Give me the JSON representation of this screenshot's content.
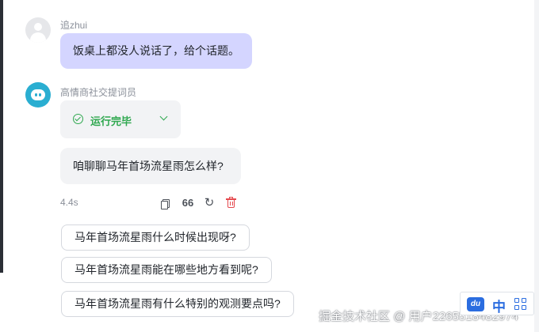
{
  "chat": {
    "user_message": {
      "username": "追zhui",
      "text": "饭桌上都没人说话了，给个话题。"
    },
    "bot_message": {
      "bot_name": "高情商社交提词员",
      "status_label": "运行完毕",
      "answer": "咱聊聊马年首场流星雨怎么样?",
      "elapsed_time": "4.4s",
      "toolbar": {
        "quote_label": "66"
      }
    },
    "suggestions": [
      "马年首场流星雨什么时候出现呀?",
      "马年首场流星雨能在哪些地方看到呢?",
      "马年首场流星雨有什么特别的观测要点吗?"
    ]
  },
  "watermark": "掘金技术社区 @ 用户2265518482974",
  "ime": {
    "logo_text": "du",
    "language": "中"
  },
  "colors": {
    "user_bubble": "#d4d5ff",
    "status_green": "#2fa84f",
    "delete_red": "#e5484d",
    "ime_blue": "#2b6de0"
  },
  "icons": {
    "status": "check-circle-icon",
    "toggle": "chevron-down-icon",
    "copy": "copy-icon",
    "quote": "quote-icon",
    "regenerate": "refresh-icon",
    "delete": "trash-icon"
  }
}
